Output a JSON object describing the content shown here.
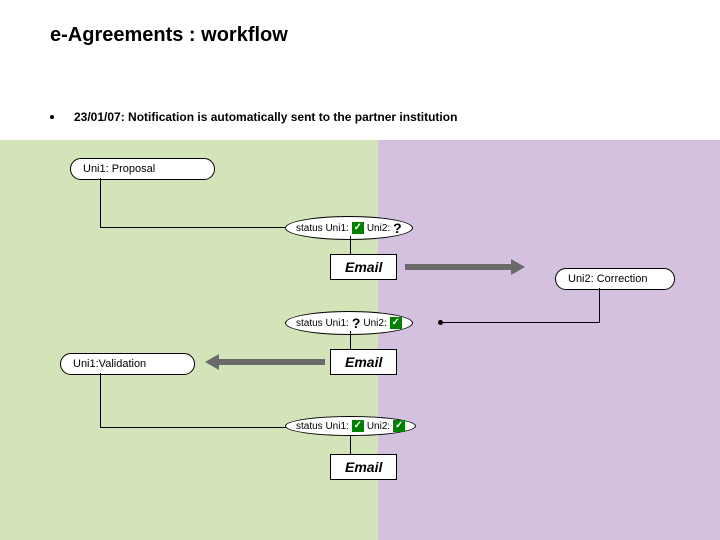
{
  "title": "e-Agreements : workflow",
  "bullet": "23/01/07: Notification is automatically sent to the partner institution",
  "boxes": {
    "proposal": "Uni1: Proposal",
    "correction": "Uni2: Correction",
    "validation": "Uni1:Validation"
  },
  "status": {
    "label_uni1": "status Uni1:",
    "label_uni2": "Uni2:",
    "question": "?",
    "check": "✓"
  },
  "email": "Email",
  "chart_data": {
    "type": "diagram",
    "title": "e-Agreements : workflow",
    "note": "23/01/07: Notification is automatically sent to the partner institution",
    "lanes": [
      "Uni1",
      "Uni2"
    ],
    "steps": [
      {
        "id": "proposal",
        "lane": "Uni1",
        "label": "Uni1: Proposal"
      },
      {
        "id": "status1",
        "type": "status",
        "uni1": "ok",
        "uni2": "?",
        "leads_to": "email1"
      },
      {
        "id": "email1",
        "type": "message",
        "label": "Email",
        "direction": "Uni1->Uni2",
        "leads_to": "correction"
      },
      {
        "id": "correction",
        "lane": "Uni2",
        "label": "Uni2: Correction"
      },
      {
        "id": "status2",
        "type": "status",
        "uni1": "?",
        "uni2": "ok",
        "leads_to": "email2"
      },
      {
        "id": "email2",
        "type": "message",
        "label": "Email",
        "direction": "Uni2->Uni1",
        "leads_to": "validation"
      },
      {
        "id": "validation",
        "lane": "Uni1",
        "label": "Uni1:Validation"
      },
      {
        "id": "status3",
        "type": "status",
        "uni1": "ok",
        "uni2": "ok",
        "leads_to": "email3"
      },
      {
        "id": "email3",
        "type": "message",
        "label": "Email",
        "direction": "Uni1->Uni2"
      }
    ]
  }
}
